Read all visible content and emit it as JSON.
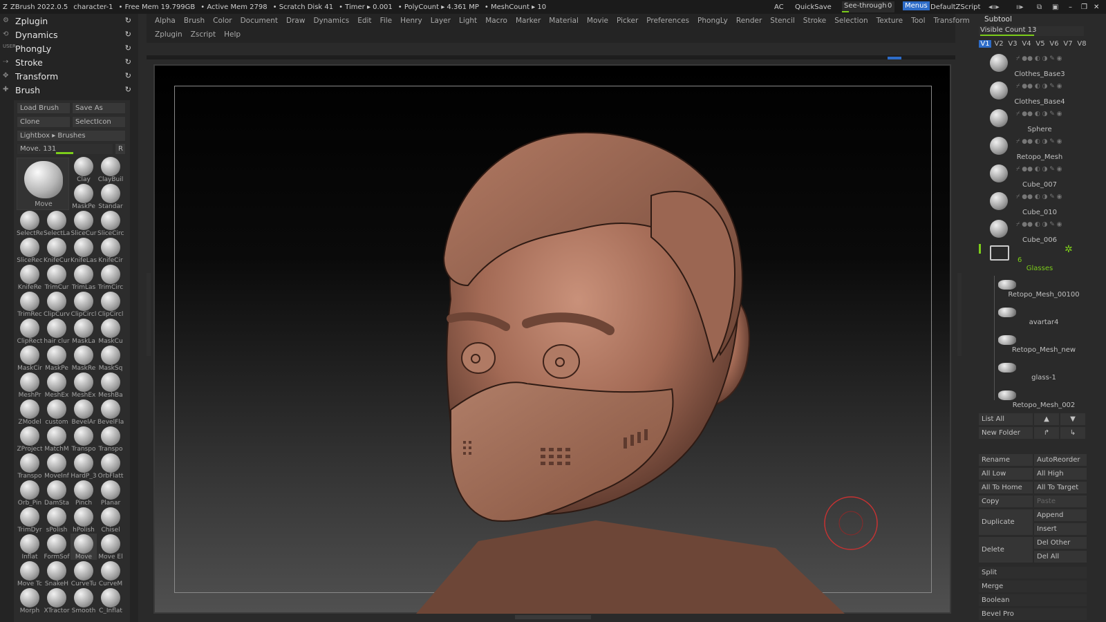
{
  "topbar": {
    "app": "ZBrush 2022.0.5",
    "doc": "character-1",
    "freemem": "• Free Mem 19.799GB",
    "activemem": "• Active Mem 2798",
    "scratch": "• Scratch Disk 41",
    "timer": "• Timer ▸ 0.001",
    "polycount": "• PolyCount ▸ 4.361 MP",
    "meshcount": "• MeshCount ▸ 10",
    "ac": "AC",
    "quicksave": "QuickSave",
    "seethrough": "See-through",
    "seethrough_value": "0",
    "menus": "Menus",
    "script": "DefaultZScript"
  },
  "menus_row1": [
    "Alpha",
    "Brush",
    "Color",
    "Document",
    "Draw",
    "Dynamics",
    "Edit",
    "File",
    "Henry",
    "Layer",
    "Light",
    "Macro",
    "Marker",
    "Material",
    "Movie",
    "Picker",
    "Preferences",
    "PhongLy",
    "Render",
    "Stencil",
    "Stroke",
    "Selection",
    "Texture",
    "Tool",
    "Transform"
  ],
  "menus_row2": [
    "Zplugin",
    "Zscript",
    "Help"
  ],
  "palettes": [
    "Zplugin",
    "Dynamics",
    "PhongLy",
    "Stroke",
    "Transform",
    "Brush"
  ],
  "user_tag": "USER",
  "brush": {
    "load": "Load Brush",
    "saveas": "Save As",
    "clone": "Clone",
    "selecticon": "SelectIcon",
    "lightbox": "Lightbox ▸ Brushes",
    "move_label": "Move.",
    "move_value": "131",
    "move_value_fraction": 0.42,
    "r": "R",
    "current": "Move"
  },
  "brushes": [
    "Clay",
    "ClayBuil",
    "MaskPe",
    "Standar",
    "SelectRe",
    "SelectLa",
    "SliceCur",
    "SliceCirc",
    "SliceRec",
    "KnifeCur",
    "KnifeLas",
    "KnifeCir",
    "KnifeRe",
    "TrimCur",
    "TrimLas",
    "TrimCirc",
    "TrimRec",
    "ClipCurv",
    "ClipCircl",
    "ClipCircl",
    "ClipRect",
    "hair clur",
    "MaskLa",
    "MaskCu",
    "MaskCir",
    "MaskPe",
    "MaskRe",
    "MaskSq",
    "MeshPr",
    "MeshEx",
    "MeshEx",
    "MeshBa",
    "ZModel",
    "custom",
    "BevelAr",
    "BevelFla",
    "ZProject",
    "MatchM",
    "Transpo",
    "Transpo",
    "Transpo",
    "MoveInf",
    "HardP_3",
    "OrbFlatt",
    "Orb_Pin",
    "DamSta",
    "Pinch",
    "Planar",
    "TrimDyr",
    "sPolish",
    "hPolish",
    "Chisel",
    "Inflat",
    "FormSof",
    "Move",
    "Move El",
    "Move Tc",
    "SnakeH",
    "CurveTu",
    "CurveM",
    "Morph",
    "XTractor",
    "Smooth",
    "C_Inflat"
  ],
  "subtool": {
    "title": "Subtool",
    "visible_count_label": "Visible Count",
    "visible_count": "13",
    "visible_count_fraction": 0.65,
    "versions": [
      "V1",
      "V2",
      "V3",
      "V4",
      "V5",
      "V6",
      "V7",
      "V8"
    ],
    "items": [
      "Clothes_Base3",
      "Clothes_Base4",
      "Sphere",
      "Retopo_Mesh",
      "Cube_007",
      "Cube_010",
      "Cube_006"
    ],
    "folder_count": "6",
    "folder_name": "Glasses",
    "folder_items": [
      "Retopo_Mesh_00100",
      "avartar4",
      "Retopo_Mesh_new",
      "glass-1",
      "Retopo_Mesh_002"
    ],
    "listall": "List All",
    "newfolder": "New Folder",
    "buttons": {
      "rename": "Rename",
      "autoreorder": "AutoReorder",
      "alllow": "All Low",
      "allhigh": "All High",
      "alltohome": "All To Home",
      "alltotarget": "All To Target",
      "copy": "Copy",
      "paste": "Paste",
      "duplicate": "Duplicate",
      "append": "Append",
      "insert": "Insert",
      "delete": "Delete",
      "delother": "Del Other",
      "delall": "Del All"
    },
    "sections": [
      "Split",
      "Merge",
      "Boolean",
      "Bevel Pro"
    ]
  },
  "colors": {
    "accent": "#2d6cc8",
    "active_green": "#7ccd1a",
    "brush_ring": "#c83232"
  }
}
